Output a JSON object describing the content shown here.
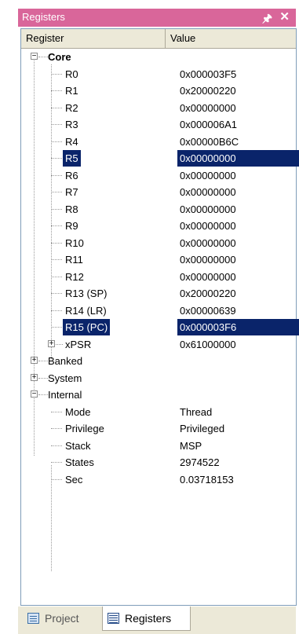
{
  "window": {
    "title": "Registers"
  },
  "columns": {
    "register": "Register",
    "value": "Value"
  },
  "tree": {
    "core": {
      "label": "Core",
      "registers": [
        {
          "name": "R0",
          "value": "0x000003F5"
        },
        {
          "name": "R1",
          "value": "0x20000220"
        },
        {
          "name": "R2",
          "value": "0x00000000"
        },
        {
          "name": "R3",
          "value": "0x000006A1"
        },
        {
          "name": "R4",
          "value": "0x00000B6C"
        },
        {
          "name": "R5",
          "value": "0x00000000"
        },
        {
          "name": "R6",
          "value": "0x00000000"
        },
        {
          "name": "R7",
          "value": "0x00000000"
        },
        {
          "name": "R8",
          "value": "0x00000000"
        },
        {
          "name": "R9",
          "value": "0x00000000"
        },
        {
          "name": "R10",
          "value": "0x00000000"
        },
        {
          "name": "R11",
          "value": "0x00000000"
        },
        {
          "name": "R12",
          "value": "0x00000000"
        },
        {
          "name": "R13 (SP)",
          "value": "0x20000220"
        },
        {
          "name": "R14 (LR)",
          "value": "0x00000639"
        },
        {
          "name": "R15 (PC)",
          "value": "0x000003F6"
        }
      ],
      "xpsr": {
        "name": "xPSR",
        "value": "0x61000000"
      }
    },
    "banked": {
      "label": "Banked"
    },
    "system": {
      "label": "System"
    },
    "internal": {
      "label": "Internal",
      "items": [
        {
          "name": "Mode",
          "value": "Thread"
        },
        {
          "name": "Privilege",
          "value": "Privileged"
        },
        {
          "name": "Stack",
          "value": "MSP"
        },
        {
          "name": "States",
          "value": "2974522"
        },
        {
          "name": "Sec",
          "value": "0.03718153"
        }
      ]
    }
  },
  "tabs": {
    "project": "Project",
    "registers": "Registers"
  },
  "colors": {
    "title_bar": "#d9669a",
    "selection": "#0a246a"
  }
}
